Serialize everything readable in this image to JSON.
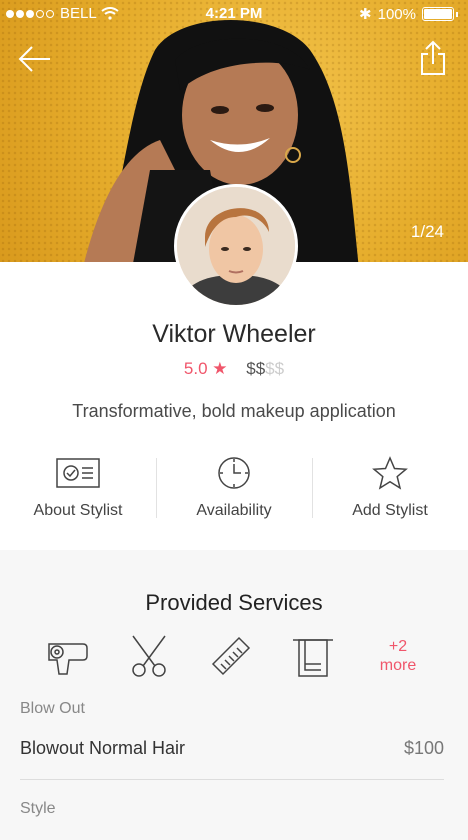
{
  "status_bar": {
    "carrier": "BELL",
    "time": "4:21 PM",
    "battery": "100%"
  },
  "hero": {
    "photo_counter": "1/24",
    "back_icon": "arrow-left-icon",
    "share_icon": "share-icon"
  },
  "stylist": {
    "name": "Viktor Wheeler",
    "rating": "5.0",
    "price_active": "$$",
    "price_inactive": "$$",
    "tagline": "Transformative, bold makeup application"
  },
  "actions": [
    {
      "label": "About Stylist",
      "icon": "id-card-icon"
    },
    {
      "label": "Availability",
      "icon": "clock-icon"
    },
    {
      "label": "Add Stylist",
      "icon": "star-outline-icon"
    }
  ],
  "services": {
    "title": "Provided Services",
    "icons": [
      "hair-dryer-icon",
      "scissors-icon",
      "comb-icon",
      "towel-icon"
    ],
    "more_count": "+2",
    "more_label": "more",
    "categories": [
      {
        "name": "Blow Out",
        "items": [
          {
            "name": "Blowout Normal Hair",
            "price": "$100"
          }
        ]
      },
      {
        "name": "Style",
        "items": []
      }
    ]
  },
  "colors": {
    "accent": "#f0566b",
    "hero_bg": "#e6ad2c"
  }
}
